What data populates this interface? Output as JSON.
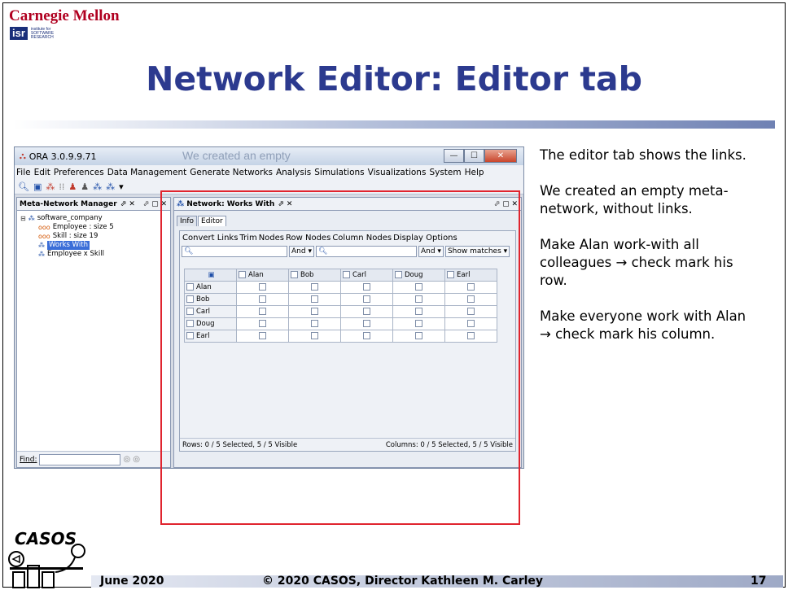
{
  "slide": {
    "org_name": "Carnegie Mellon",
    "isr_badge": "isr",
    "isr_text": "institute for SOFTWARE RESEARCH",
    "title": "Network Editor: Editor tab",
    "logo_text": "CASOS",
    "footer_date": "June 2020",
    "footer_copyright": "© 2020 CASOS, Director Kathleen M. Carley",
    "page_number": "17",
    "accent_color": "#2c3a8f",
    "highlight_color": "#e0242e"
  },
  "app": {
    "title": "ORA 3.0.9.9.71",
    "overlay_text": "We created an empty",
    "menu": [
      "File",
      "Edit",
      "Preferences",
      "Data Management",
      "Generate Networks",
      "Analysis",
      "Simulations",
      "Visualizations",
      "System",
      "Help"
    ],
    "left_panel": {
      "title": "Meta-Network Manager",
      "tree": {
        "root": "software_company",
        "items": [
          "Employee : size 5",
          "Skill : size 19",
          "Works With",
          "Employee x Skill"
        ],
        "selected": "Works With"
      },
      "find_label": "Find:"
    },
    "right_panel": {
      "title": "Network: Works With",
      "tabs": [
        "Info",
        "Editor"
      ],
      "active_tab": "Editor",
      "editor_menu": [
        "Convert Links",
        "Trim",
        "Nodes",
        "Row Nodes",
        "Column Nodes",
        "Display Options"
      ],
      "filter_left_op": "And",
      "filter_right_op": "And",
      "show_matches": "Show matches",
      "columns": [
        "Alan",
        "Bob",
        "Carl",
        "Doug",
        "Earl"
      ],
      "rows": [
        "Alan",
        "Bob",
        "Carl",
        "Doug",
        "Earl"
      ],
      "status_rows": "Rows: 0 / 5 Selected, 5 / 5 Visible",
      "status_cols": "Columns: 0 / 5 Selected, 5 / 5 Visible"
    }
  },
  "notes": [
    "The editor tab shows the links.",
    "We created an empty meta-network, without links.",
    "Make Alan work-with all colleagues → check mark his row.",
    "Make everyone work with Alan → check mark his column."
  ]
}
